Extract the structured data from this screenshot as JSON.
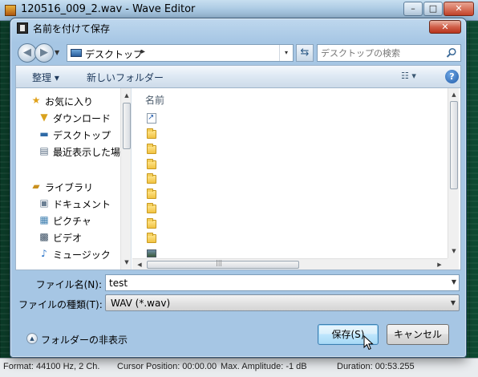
{
  "background_app": {
    "title": "120516_009_2.wav - Wave Editor",
    "window_controls": {
      "minimize": "–",
      "maximize": "□",
      "close": "✕"
    },
    "status_bar": {
      "format": "Format: 44100 Hz, 2 Ch.",
      "cursor": "Cursor Position: 00:00.00",
      "amplitude": "Max. Amplitude: -1 dB",
      "duration": "Duration: 00:53.255"
    }
  },
  "dialog": {
    "title": "名前を付けて保存",
    "close_glyph": "✕",
    "address": {
      "location": "デスクトップ",
      "separator": "▸",
      "dropdown": "▾"
    },
    "search": {
      "placeholder": "デスクトップの検索"
    },
    "toolbar": {
      "organize": "整理 ▾",
      "new_folder": "新しいフォルダー",
      "view": "☷ ▾",
      "help": "?"
    },
    "nav_pane": {
      "favorites": {
        "label": "お気に入り",
        "items": [
          {
            "label": "ダウンロード",
            "icon": "download-folder-icon"
          },
          {
            "label": "デスクトップ",
            "icon": "desktop-icon"
          },
          {
            "label": "最近表示した場所",
            "icon": "recent-places-icon"
          }
        ]
      },
      "libraries": {
        "label": "ライブラリ",
        "items": [
          {
            "label": "ドキュメント",
            "icon": "documents-icon"
          },
          {
            "label": "ピクチャ",
            "icon": "pictures-icon"
          },
          {
            "label": "ビデオ",
            "icon": "videos-icon"
          },
          {
            "label": "ミュージック",
            "icon": "music-icon"
          }
        ]
      }
    },
    "file_pane": {
      "column_header": "名前",
      "rows": [
        {
          "icon": "shortcut-icon"
        },
        {
          "icon": "folder-icon"
        },
        {
          "icon": "folder-icon"
        },
        {
          "icon": "folder-icon"
        },
        {
          "icon": "folder-icon"
        },
        {
          "icon": "folder-icon"
        },
        {
          "icon": "folder-icon"
        },
        {
          "icon": "folder-icon"
        },
        {
          "icon": "folder-icon"
        },
        {
          "icon": "image-file-icon"
        }
      ]
    },
    "file_name": {
      "label": "ファイル名(N):",
      "value": "test"
    },
    "file_type": {
      "label": "ファイルの種類(T):",
      "value": "WAV (*.wav)"
    },
    "hide_folders": "フォルダーの非表示",
    "buttons": {
      "save": "保存(S)",
      "cancel": "キャンセル"
    }
  }
}
